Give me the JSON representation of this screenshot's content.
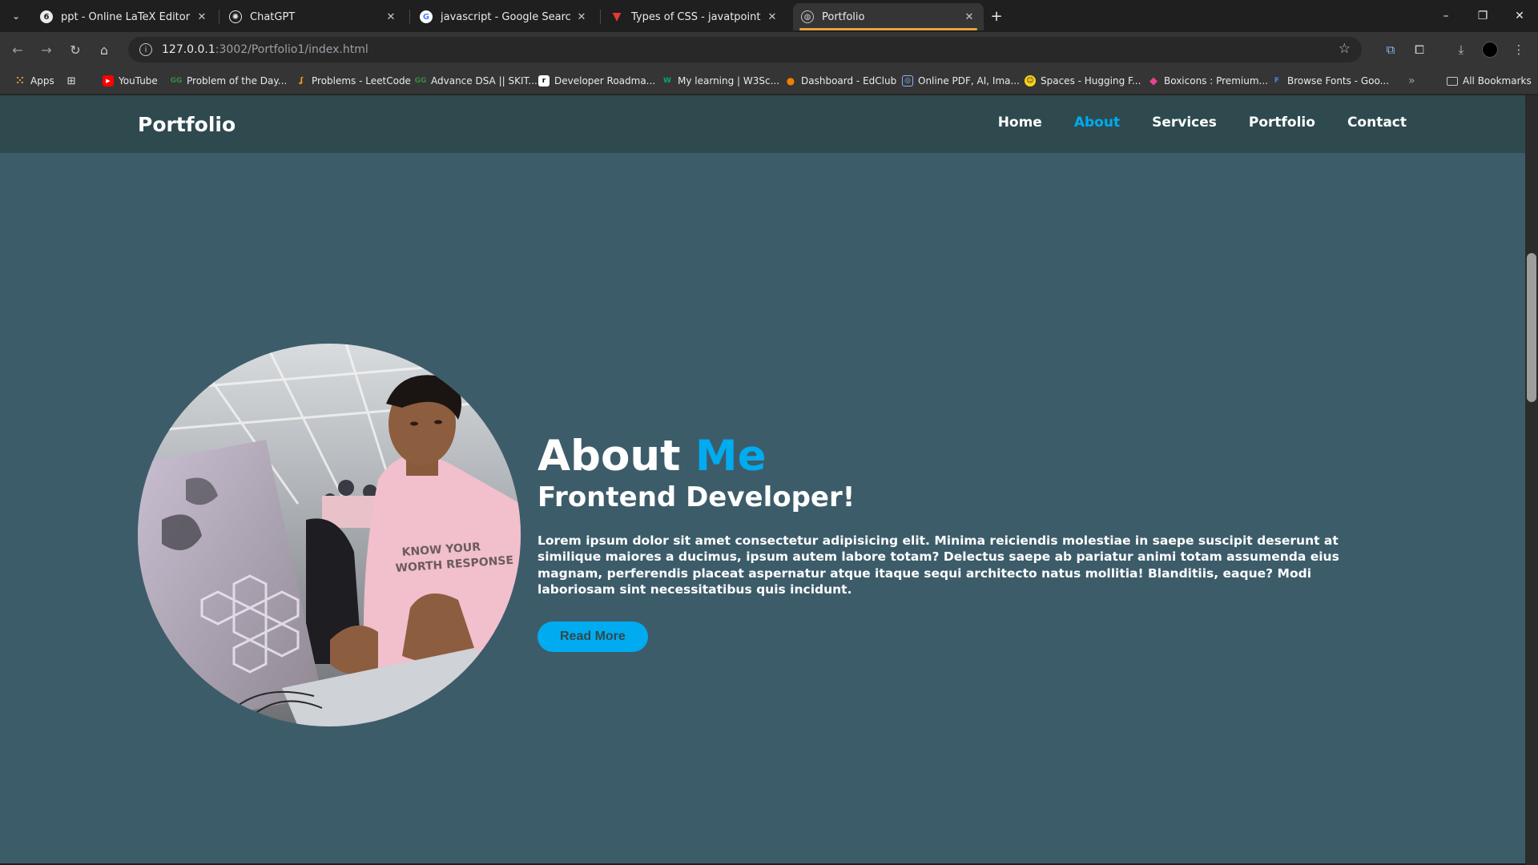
{
  "browser": {
    "tabs": [
      {
        "title": "ppt - Online LaTeX Editor Overl",
        "icon": "overleaf-icon"
      },
      {
        "title": "ChatGPT",
        "icon": "chatgpt-icon"
      },
      {
        "title": "javascript - Google Search",
        "icon": "google-icon"
      },
      {
        "title": "Types of CSS - javatpoint",
        "icon": "javatpoint-icon"
      },
      {
        "title": "Portfolio",
        "icon": "globe-icon"
      }
    ],
    "active_tab_index": 4,
    "url_host": "127.0.0.1",
    "url_path": ":3002/Portfolio1/index.html",
    "bookmarks": [
      {
        "label": "Apps",
        "icon": "apps-grid-icon"
      },
      {
        "label": "YouTube",
        "icon": "youtube-icon"
      },
      {
        "label": "Problem of the Day...",
        "icon": "gfg-icon"
      },
      {
        "label": "Problems - LeetCode",
        "icon": "leetcode-icon"
      },
      {
        "label": "Advance DSA || SKIT...",
        "icon": "gfg-icon"
      },
      {
        "label": "Developer Roadma...",
        "icon": "roadmap-icon"
      },
      {
        "label": "My learning | W3Sc...",
        "icon": "w3schools-icon"
      },
      {
        "label": "Dashboard - EdClub",
        "icon": "edclub-icon"
      },
      {
        "label": "Online PDF, AI, Ima...",
        "icon": "pdf-icon"
      },
      {
        "label": "Spaces - Hugging F...",
        "icon": "huggingface-icon"
      },
      {
        "label": "Boxicons : Premium...",
        "icon": "boxicons-icon"
      },
      {
        "label": "Browse Fonts - Goo...",
        "icon": "google-fonts-icon"
      }
    ],
    "all_bookmarks_label": "All Bookmarks",
    "colors": {
      "active_tab_indicator": "#e8a33d"
    }
  },
  "site": {
    "logo": "Portfolio",
    "nav": [
      "Home",
      "About",
      "Services",
      "Portfolio",
      "Contact"
    ],
    "active_nav": "About",
    "about": {
      "heading_part1": "About",
      "heading_part2": "Me",
      "subtitle": "Frontend Developer!",
      "body": "Lorem ipsum dolor sit amet consectetur adipisicing elit. Minima reiciendis molestiae in saepe suscipit deserunt at similique maiores a ducimus, ipsum autem labore totam? Delectus saepe ab pariatur animi totam assumenda eius magnam, perferendis placeat aspernatur atque itaque sequi architecto natus mollitia! Blanditiis, eaque? Modi laboriosam sint necessitatibus quis incidunt.",
      "button": "Read More"
    },
    "colors": {
      "accent": "#00abf0",
      "background": "#3d5c6a",
      "header": "#2f4a4f"
    }
  }
}
